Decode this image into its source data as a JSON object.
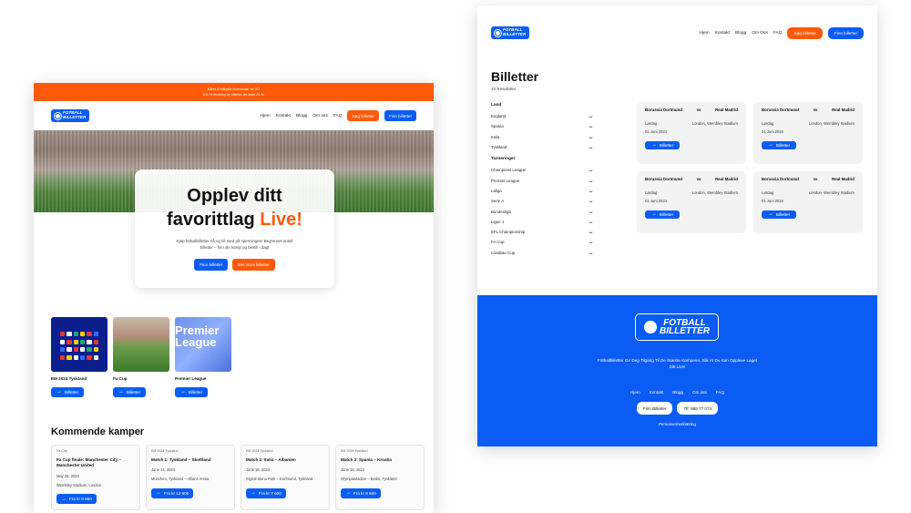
{
  "brand": {
    "logo_line1": "FOTBALL",
    "logo_line2": "BILLETTER",
    "accent": "#0a5cf5",
    "orange": "#ff5a0a"
  },
  "left": {
    "promo": [
      "Kåret til billigste leverandør av VG",
      "100 % levering av billetter de siste 20 år."
    ],
    "nav": {
      "links": [
        "Hjem",
        "Kontakt",
        "Blogg",
        "Om oss",
        "FAQ"
      ],
      "search_button": "Søg billetter",
      "find_button": "Finn billetter"
    },
    "hero": {
      "title_line1": "Opplev ditt",
      "title_line2": "favorittlag",
      "title_live": "Live!",
      "subtitle": "Kjøp fotballbilletter nå og bli med på spenningen! Begrenset antall billetter – finn din kamp og bestill i dag!",
      "btn_find": "Finn billetter",
      "btn_em": "EM 2024 billetter"
    },
    "categories": [
      {
        "label": "EM 2024 Tyskland",
        "button": "Billetter",
        "image": "em-2024"
      },
      {
        "label": "Fa Cup",
        "button": "Billetter",
        "image": "stadium"
      },
      {
        "label": "Premier League",
        "button": "Billetter",
        "image": "premier-league",
        "image_text": "Premier League"
      }
    ],
    "upcoming_title": "Kommende kamper",
    "matches": [
      {
        "competition": "Fa Cup",
        "title": "Fa Cup finale: Manchester City – Manchester United",
        "date": "May 25, 2024",
        "venue": "Wembley Stadium, London",
        "price": "Fra kr 8 880"
      },
      {
        "competition": "EM 2024 Tyskland",
        "title": "Match 1: Tyskland – Skottland",
        "date": "June 14, 2024",
        "venue": "München, Tyskland – Allianz Arena",
        "price": "Fra kr 12 500"
      },
      {
        "competition": "EM 2024 Tyskland",
        "title": "Match 2: Italia – Albanien",
        "date": "June 15, 2024",
        "venue": "Signal Iduna Park – Dortmund, Tyskland",
        "price": "Fra kr 7 600"
      },
      {
        "competition": "EM 2024 Tyskland",
        "title": "Match 3: Spania – Kroatia",
        "date": "June 15, 2024",
        "venue": "Olympiastadion – Berlin, Tyskland",
        "price": "Fra kr 8 500"
      }
    ]
  },
  "right": {
    "nav": {
      "links": [
        "Hjem",
        "Kontakt",
        "Blogg",
        "Om Oss",
        "FAQ"
      ],
      "search_button": "Søg billetter",
      "find_button": "Finn billetter"
    },
    "title": "Billetter",
    "count": "10 Resultater",
    "filters": {
      "country_heading": "Land",
      "countries": [
        "England",
        "Spania",
        "Italia",
        "Tyskland"
      ],
      "tournament_heading": "Turneringer",
      "tournaments": [
        "Champions League",
        "Premier League",
        "Laliga",
        "Serie A",
        "Bundesliga",
        "Ligue 1",
        "EFL Championship",
        "FA Cup",
        "Carabao Cup"
      ]
    },
    "tickets": [
      {
        "home": "Borussia Dortmund",
        "vs": "vs",
        "away": "Real Madrid",
        "day": "Lørdag",
        "venue": "London, Wembley Stadium",
        "date": "01 Juni 2024",
        "button": "Billetter"
      },
      {
        "home": "Borussia Dortmund",
        "vs": "vs",
        "away": "Real Madrid",
        "day": "Lørdag",
        "venue": "London, Wembley Stadium",
        "date": "01 Juni 2024",
        "button": "Billetter"
      },
      {
        "home": "Borussia Dortmund",
        "vs": "vs",
        "away": "Real Madrid",
        "day": "Lørdag",
        "venue": "London, Wembley Stadium",
        "date": "01 Juni 2024",
        "button": "Billetter"
      },
      {
        "home": "Borussia Dortmund",
        "vs": "vs",
        "away": "Real Madrid",
        "day": "Lørdag",
        "venue": "London, Wembley Stadium",
        "date": "01 Juni 2024",
        "button": "Billetter"
      }
    ],
    "footer": {
      "tagline": "Fotballbilletter Gir Deg Tilgang Til De Største Kampene, Slik At Du Kan Oppleve Laget Ditt Live!",
      "links": [
        "Hjem",
        "Kontakt",
        "Blogg",
        "Om oss",
        "FAQ"
      ],
      "btn_find": "Finn Billetter",
      "btn_phone": "Tlf: 986 77 074",
      "privacy": "Personvernerklæring"
    }
  }
}
